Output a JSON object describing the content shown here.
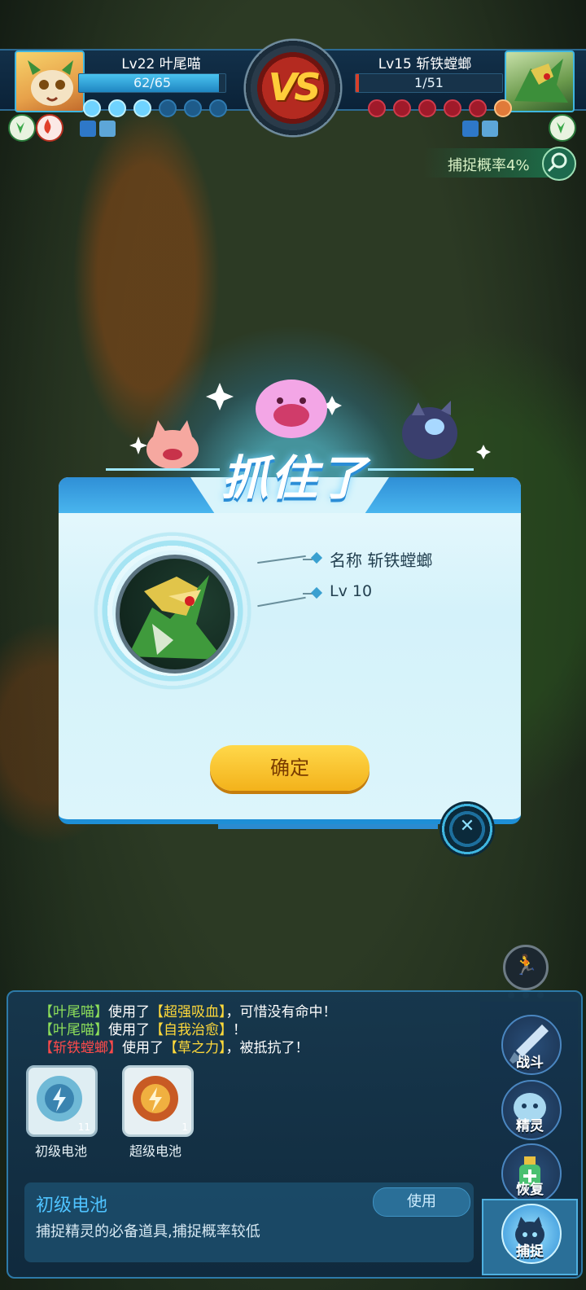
{
  "player": {
    "level_name": "Lv22 叶尾喵",
    "hp": "62/65",
    "hp_fraction": 0.954
  },
  "opponent": {
    "level_name": "Lv15 斩铁螳螂",
    "hp": "1/51",
    "hp_fraction": 0.02
  },
  "vs_label": "VS",
  "capture_rate": "捕捉概率4%",
  "popup": {
    "title": "抓住了",
    "name_label": "名称 斩铁螳螂",
    "level_label": "Lv 10",
    "confirm": "确定"
  },
  "battle_log": [
    {
      "parts": [
        {
          "t": "【叶尾喵】",
          "c": "g"
        },
        {
          "t": "使用了",
          "c": "w"
        },
        {
          "t": "【超强吸血】",
          "c": "y"
        },
        {
          "t": "，可惜没有命中！",
          "c": "w"
        }
      ]
    },
    {
      "parts": [
        {
          "t": "【叶尾喵】",
          "c": "g"
        },
        {
          "t": "使用了",
          "c": "w"
        },
        {
          "t": "【自我治愈】",
          "c": "y"
        },
        {
          "t": "！",
          "c": "w"
        }
      ]
    },
    {
      "parts": [
        {
          "t": "【斩铁螳螂】",
          "c": "r"
        },
        {
          "t": "使用了",
          "c": "w"
        },
        {
          "t": "【草之力】",
          "c": "y"
        },
        {
          "t": "，被抵抗了！",
          "c": "w"
        }
      ]
    }
  ],
  "items": [
    {
      "label": "初级电池",
      "count": "11"
    },
    {
      "label": "超级电池",
      "count": "1"
    }
  ],
  "selected_item": {
    "title": "初级电池",
    "description": "捕捉精灵的必备道具,捕捉概率较低",
    "use_label": "使用"
  },
  "side_menu": {
    "fight": "战斗",
    "spirit": "精灵",
    "recover": "恢复",
    "capture": "捕捉"
  },
  "colors": {
    "accent": "#2f8fd6",
    "confirm": "#f3b21b",
    "panel": "#16374e"
  }
}
